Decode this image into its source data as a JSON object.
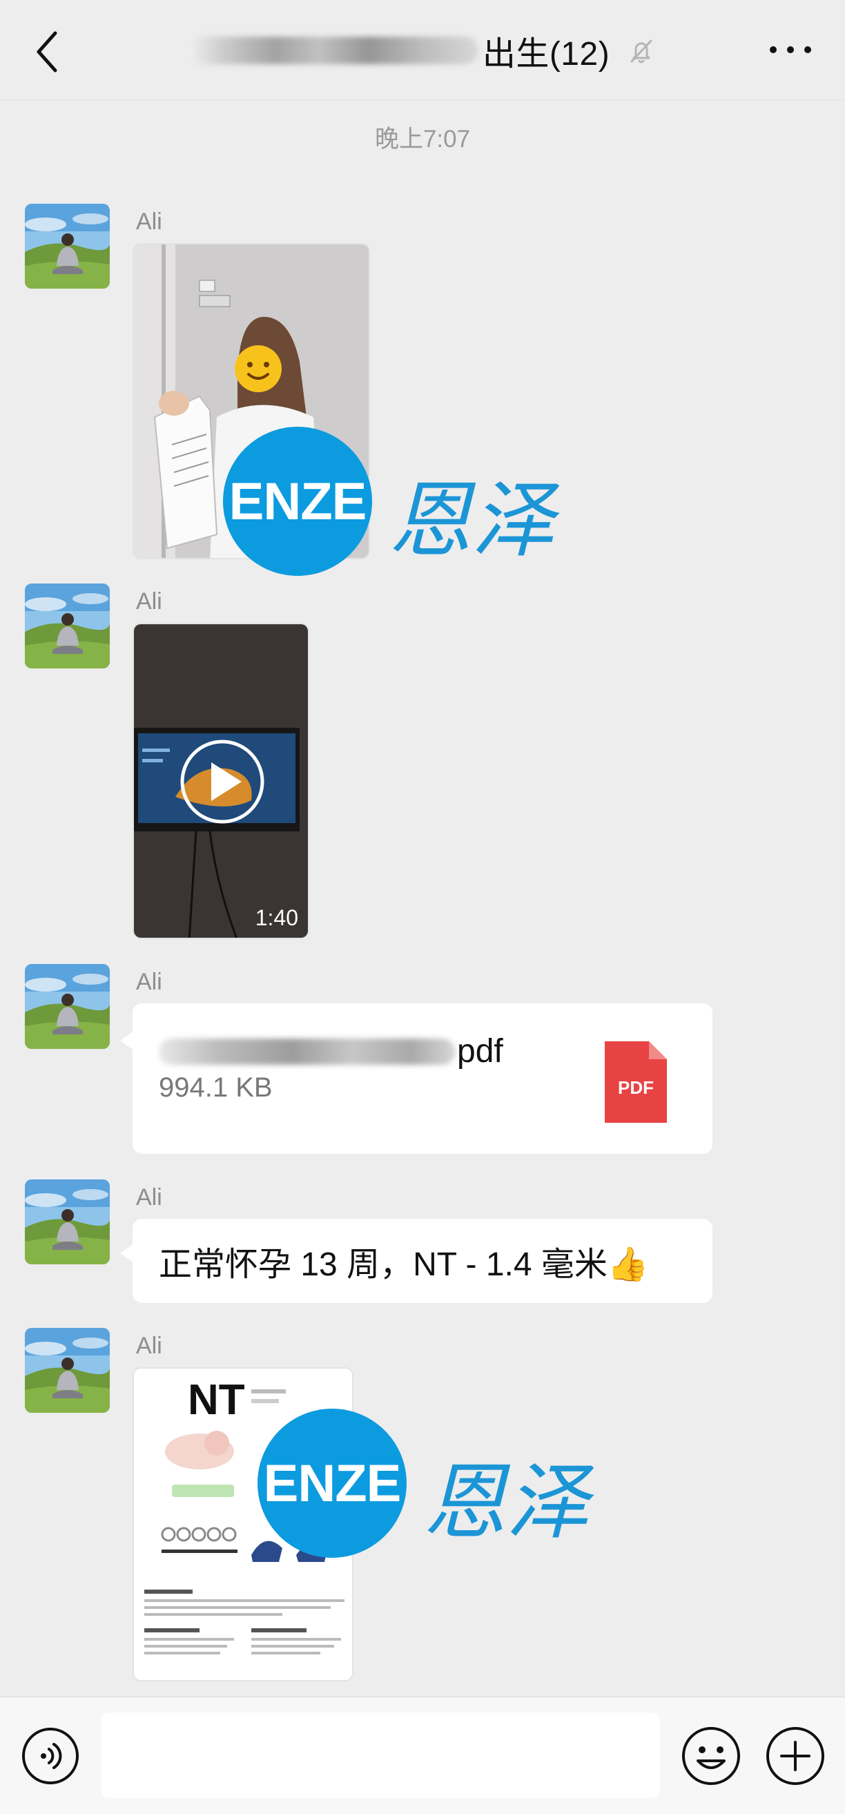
{
  "header": {
    "title_suffix": "出生(12)",
    "back_icon": "chevron-left-icon",
    "mute_icon": "bell-off-icon",
    "more_icon": "more-dots-icon"
  },
  "timestamp": "晚上7:07",
  "messages": [
    {
      "type": "image",
      "sender": "Ali"
    },
    {
      "type": "video",
      "sender": "Ali",
      "duration": "1:40"
    },
    {
      "type": "file",
      "sender": "Ali",
      "file_ext": "pdf",
      "file_size": "994.1 KB",
      "file_icon_label": "PDF"
    },
    {
      "type": "text",
      "sender": "Ali",
      "text": "正常怀孕 13 周，NT - 1.4 毫米👍"
    },
    {
      "type": "image",
      "sender": "Ali",
      "image_label": "NT"
    }
  ],
  "watermark": {
    "latin": "ENZE",
    "chinese": "恩泽"
  },
  "input_bar": {
    "input_placeholder": "",
    "voice_icon": "voice-icon",
    "emoji_icon": "emoji-icon",
    "plus_icon": "plus-icon"
  },
  "colors": {
    "background": "#ededed",
    "watermark_blue": "#0d9be0",
    "pdf_red": "#e84343"
  }
}
